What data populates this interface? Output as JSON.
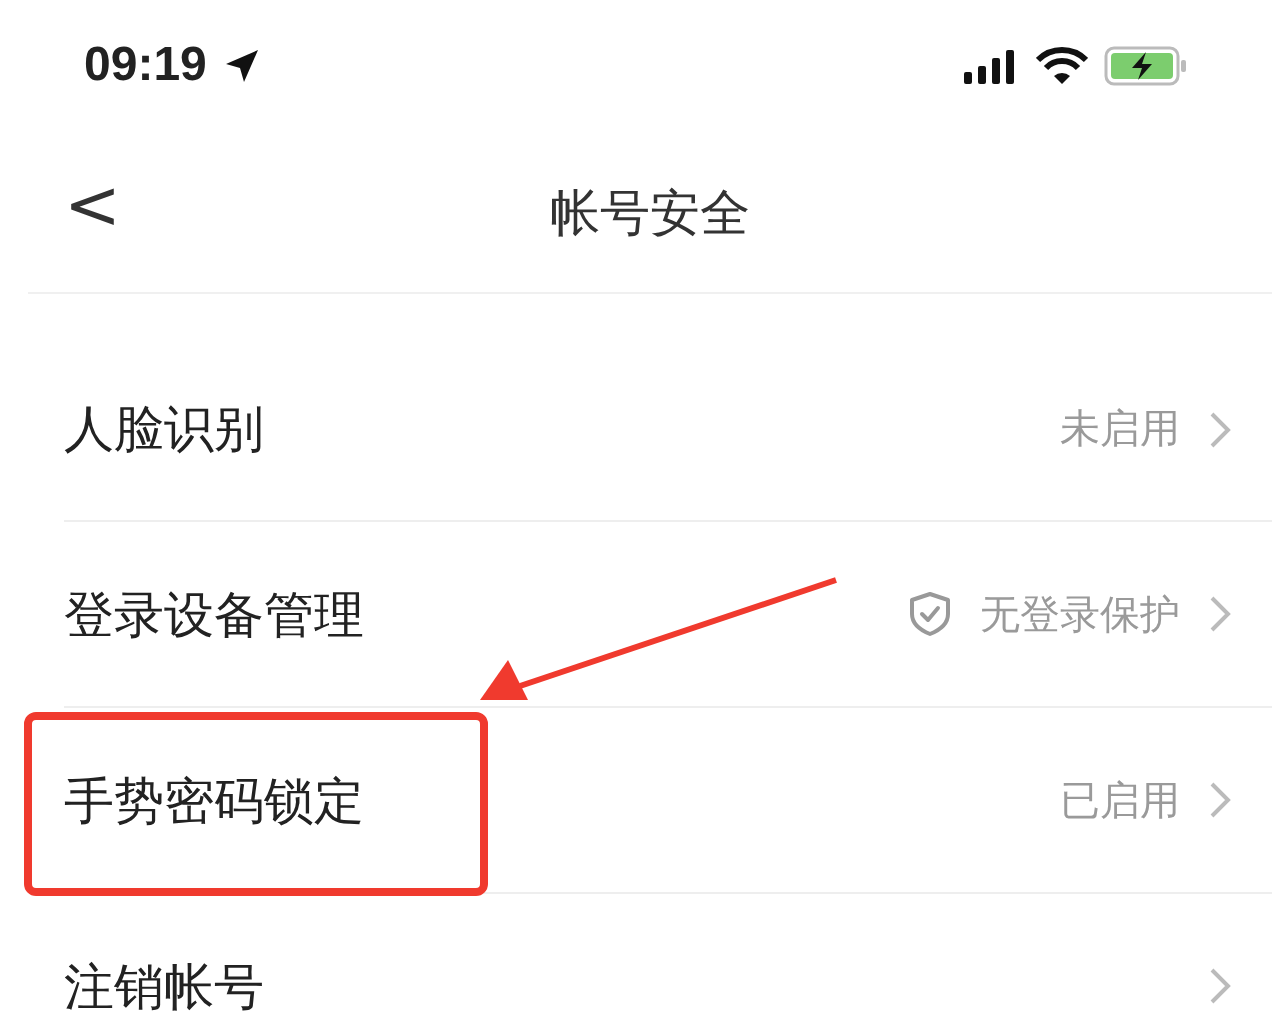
{
  "status_bar": {
    "time": "09:19",
    "location_on": true,
    "charging": true
  },
  "nav": {
    "back": "<",
    "title": "帐号安全"
  },
  "rows": [
    {
      "label": "人脸识别",
      "value": "未启用",
      "shield": false,
      "annotated": false
    },
    {
      "label": "登录设备管理",
      "value": "无登录保护",
      "shield": true,
      "annotated": false
    },
    {
      "label": "手势密码锁定",
      "value": "已启用",
      "shield": false,
      "annotated": true
    },
    {
      "label": "注销帐号",
      "value": "",
      "shield": false,
      "annotated": false
    }
  ]
}
